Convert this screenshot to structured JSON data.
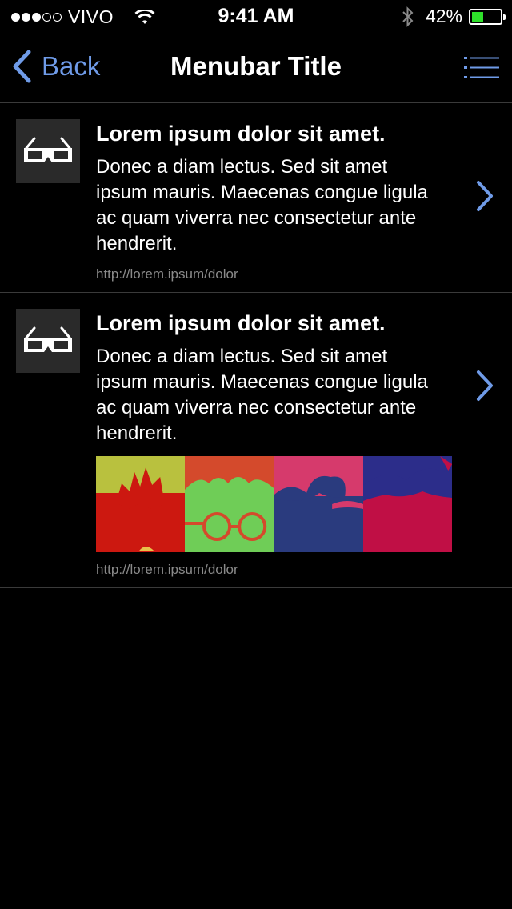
{
  "status_bar": {
    "signal_filled": 3,
    "signal_total": 5,
    "carrier": "VIVO",
    "time": "9:41 AM",
    "battery_percent": "42%",
    "battery_level": 0.42,
    "battery_color": "#2ee02a"
  },
  "navbar": {
    "back_label": "Back",
    "title": "Menubar Title",
    "accent_color": "#6f9be8",
    "menu_icon": "list-menu-icon"
  },
  "items": [
    {
      "icon": "3d-glasses-icon",
      "title": "Lorem ipsum dolor sit amet.",
      "description": "Donec a diam lectus. Sed sit amet ipsum mauris. Maecenas congue ligula ac quam viverra nec consectetur ante hendrerit.",
      "url": "http://lorem.ipsum/dolor"
    },
    {
      "icon": "3d-glasses-icon",
      "title": "Lorem ipsum dolor sit amet.",
      "description": "Donec a diam lectus. Sed sit amet ipsum mauris. Maecenas congue ligula ac quam viverra nec consectetur ante hendrerit.",
      "image": "pop-art-band-portraits",
      "url": "http://lorem.ipsum/dolor"
    }
  ]
}
